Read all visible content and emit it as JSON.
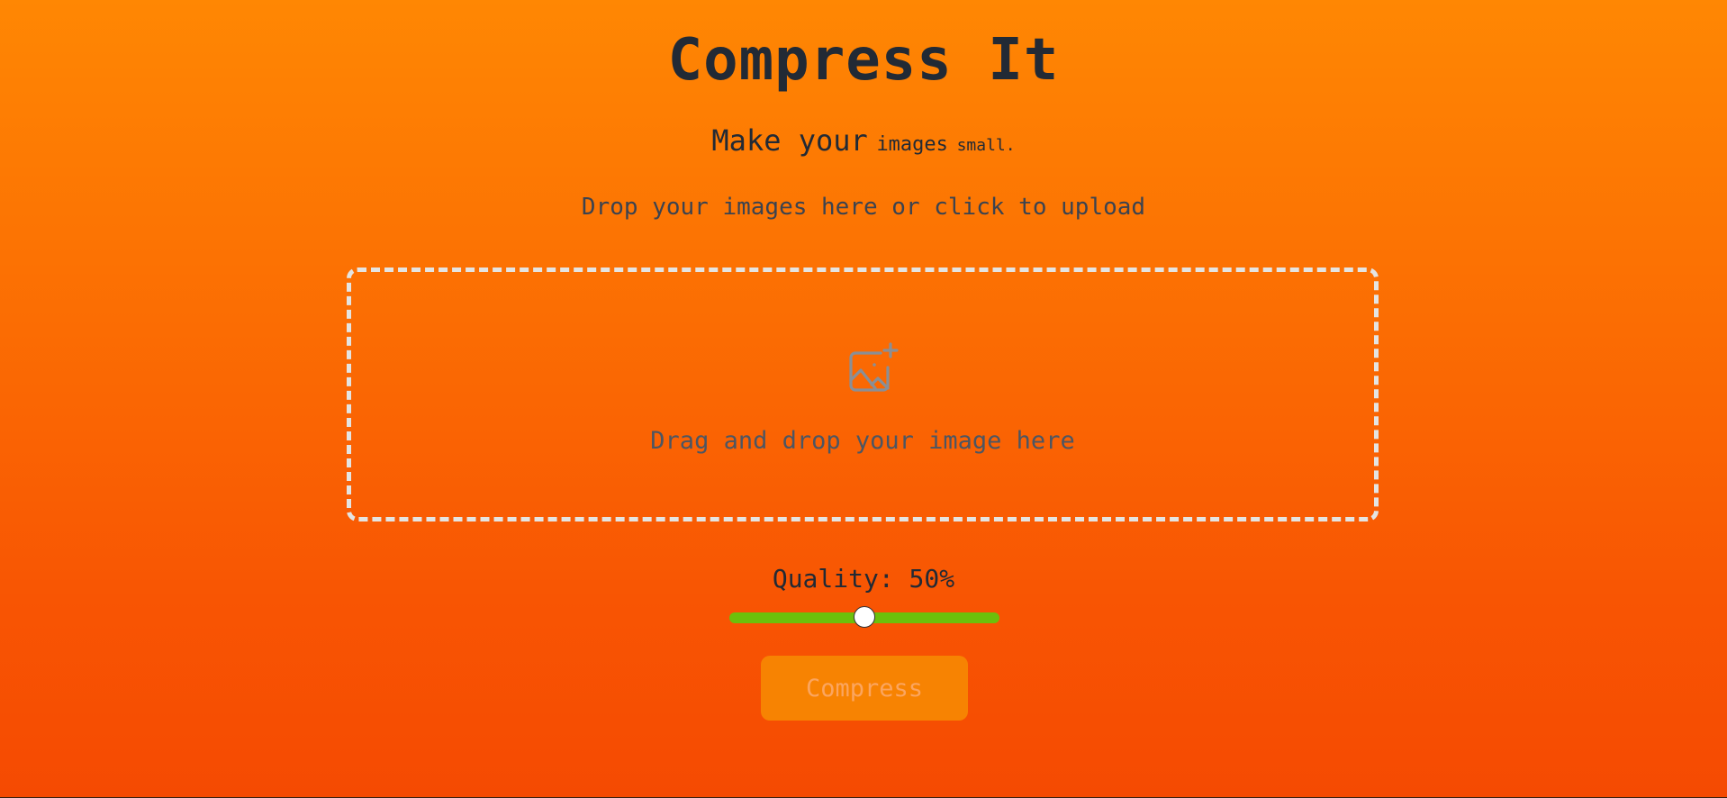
{
  "header": {
    "title": "Compress It",
    "tagline": {
      "part1": "Make your",
      "part2": "images",
      "part3": "small."
    },
    "upload_hint": "Drop your images here or click to upload"
  },
  "dropzone": {
    "icon": "image-plus-icon",
    "text": "Drag and drop your image here"
  },
  "quality": {
    "label": "Quality: 50%",
    "value": 50,
    "min": 0,
    "max": 100
  },
  "actions": {
    "compress_label": "Compress"
  },
  "colors": {
    "gradient_top": "#ff8703",
    "gradient_bottom": "#f54a02",
    "title_text": "#222a35",
    "slider_track": "#6cc00b",
    "button_bg": "#f78302",
    "button_text": "#fba55f",
    "dropzone_border": "#e4e4e2"
  }
}
